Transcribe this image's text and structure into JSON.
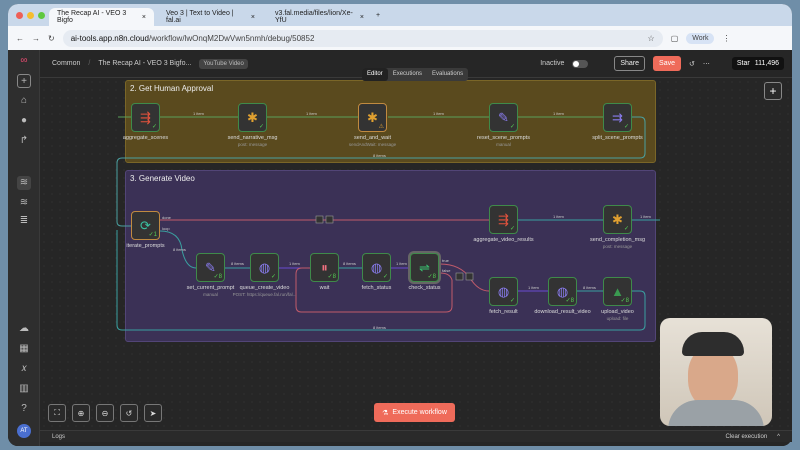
{
  "browser": {
    "tabs": [
      {
        "label": "The Recap AI - VEO 3 Bigfo",
        "active": true
      },
      {
        "label": "Veo 3 | Text to Video | fal.ai"
      },
      {
        "label": "v3.fal.media/files/lion/Xe-YfU"
      }
    ],
    "url_host": "ai-tools.app.n8n.cloud",
    "url_path": "/workflow/lwOnqM2DwVwn5nmh/debug/50852",
    "profile": "Work"
  },
  "header": {
    "project": "Common",
    "title": "The Recap AI - VEO 3 Bigfo...",
    "tag": "YouTube Video",
    "inactive_label": "Inactive",
    "active": false,
    "share": "Share",
    "save": "Save",
    "star": "Star",
    "stars": "111,496"
  },
  "view_tabs": [
    "Editor",
    "Executions",
    "Evaluations"
  ],
  "groups": [
    {
      "title": "2. Get Human Approval",
      "color": "#5a4a1e"
    },
    {
      "title": "3. Generate Video",
      "color": "#3b3156"
    }
  ],
  "nodes": {
    "aggregate_scenes": {
      "label": "aggregate_scenes",
      "icon": "aggregate-icon"
    },
    "send_narrative_msg": {
      "label": "send_narrative_msg",
      "sub": "post: message",
      "icon": "slack-icon"
    },
    "send_and_wait": {
      "label": "send_and_wait",
      "sub": "sendAndWait: message",
      "icon": "slack-icon",
      "warning": true
    },
    "reset_scene_prompts": {
      "label": "reset_scene_prompts",
      "sub": "manual",
      "icon": "pencil-icon"
    },
    "split_scene_prompts": {
      "label": "split_scene_prompts",
      "icon": "split-icon"
    },
    "iterate_prompts": {
      "label": "iterate_prompts",
      "icon": "loop-icon",
      "badge": "1"
    },
    "aggregate_video_results": {
      "label": "aggregate_video_results",
      "icon": "aggregate-icon"
    },
    "send_completion_msg": {
      "label": "send_completion_msg",
      "sub": "post: message",
      "icon": "slack-icon"
    },
    "set_current_prompt": {
      "label": "set_current_prompt",
      "sub": "manual",
      "icon": "pencil-icon",
      "badge": "8"
    },
    "queue_create_video": {
      "label": "queue_create_video",
      "sub": "POST: https://queue.fal.run/fal...",
      "icon": "globe-icon"
    },
    "wait": {
      "label": "wait",
      "icon": "pause-icon",
      "badge": "8"
    },
    "fetch_status": {
      "label": "fetch_status",
      "icon": "globe-icon"
    },
    "check_status": {
      "label": "check_status",
      "icon": "if-icon",
      "badge": "8"
    },
    "fetch_result": {
      "label": "fetch_result",
      "icon": "globe-icon"
    },
    "download_result_video": {
      "label": "download_result_video",
      "icon": "globe-icon",
      "badge": "8"
    },
    "upload_video": {
      "label": "upload_video",
      "sub": "upload: file",
      "icon": "gdrive-icon",
      "badge": "8"
    }
  },
  "edge_labels": {
    "one": "1 item",
    "eight": "8 items",
    "done": "done",
    "loop": "loop",
    "true": "true",
    "false": "false"
  },
  "execute": "Execute workflow",
  "logs": "Logs",
  "clear": "Clear execution"
}
